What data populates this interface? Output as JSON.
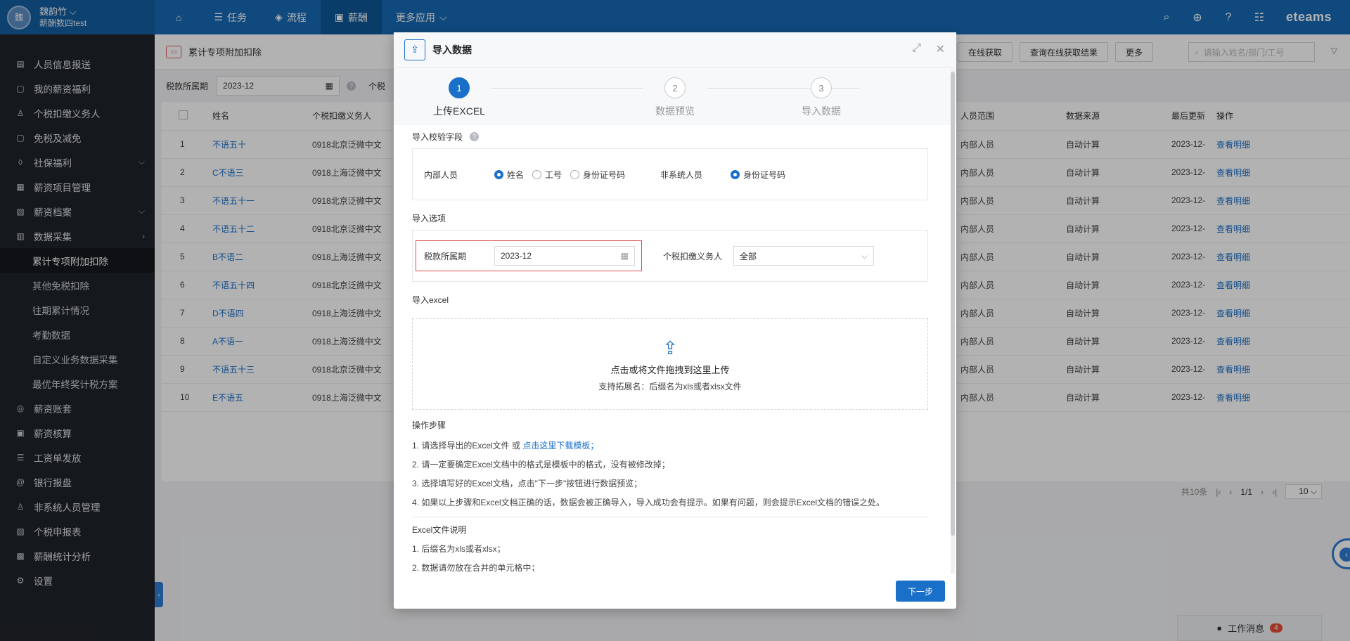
{
  "topbar": {
    "avatar_text": "魏",
    "user_name": "魏韵竹",
    "user_sub": "薪酬数四test",
    "nav": [
      {
        "label": "",
        "icon": "home-icon"
      },
      {
        "label": "任务",
        "icon": "list-icon"
      },
      {
        "label": "流程",
        "icon": "flow-icon"
      },
      {
        "label": "薪酬",
        "icon": "salary-icon",
        "active": true
      },
      {
        "label": "更多应用",
        "icon": "chevron-down-icon"
      }
    ],
    "brand": "eteams"
  },
  "sidebar": {
    "items": [
      {
        "label": "人员信息报送",
        "icon": "report-icon"
      },
      {
        "label": "我的薪资福利",
        "icon": "wallet-icon"
      },
      {
        "label": "个税扣缴义务人",
        "icon": "person-icon"
      },
      {
        "label": "免税及减免",
        "icon": "tax-icon"
      },
      {
        "label": "社保福利",
        "icon": "shield-icon",
        "arrow": "down"
      },
      {
        "label": "薪资项目管理",
        "icon": "project-icon"
      },
      {
        "label": "薪资档案",
        "icon": "archive-icon",
        "arrow": "down"
      },
      {
        "label": "数据采集",
        "icon": "data-icon",
        "arrow": "right"
      }
    ],
    "subitems": [
      {
        "label": "累计专项附加扣除",
        "active": true
      },
      {
        "label": "其他免税扣除"
      },
      {
        "label": "往期累计情况"
      },
      {
        "label": "考勤数据"
      },
      {
        "label": "自定义业务数据采集"
      },
      {
        "label": "最优年终奖计税方案"
      }
    ],
    "items2": [
      {
        "label": "薪资账套",
        "icon": "ledger-icon"
      },
      {
        "label": "薪资核算",
        "icon": "calc-icon"
      },
      {
        "label": "工资单发放",
        "icon": "payslip-icon"
      },
      {
        "label": "银行报盘",
        "icon": "bank-icon"
      },
      {
        "label": "非系统人员管理",
        "icon": "person-icon"
      },
      {
        "label": "个税申报表",
        "icon": "form-icon"
      },
      {
        "label": "薪酬统计分析",
        "icon": "chart-icon"
      },
      {
        "label": "设置",
        "icon": "gear-icon"
      }
    ]
  },
  "page": {
    "title": "累计专项附加扣除",
    "buttons": [
      "在线获取",
      "查询在线获取结果",
      "更多"
    ],
    "search_placeholder": "请输入姓名/部门/工号",
    "filter": {
      "label": "税款所属期",
      "value": "2023-12",
      "label2": "个税"
    },
    "table": {
      "headers": [
        "姓名",
        "个税扣缴义务人",
        "人员范围",
        "数据来源",
        "最后更新",
        "操作"
      ],
      "rows": [
        {
          "idx": "1",
          "name": "不语五十",
          "agent": "0918北京泛微中文",
          "scope": "内部人员",
          "source": "自动计算",
          "updated": "2023-12-",
          "op": "查看明细"
        },
        {
          "idx": "2",
          "name": "C不语三",
          "agent": "0918上海泛微中文",
          "scope": "内部人员",
          "source": "自动计算",
          "updated": "2023-12-",
          "op": "查看明细"
        },
        {
          "idx": "3",
          "name": "不语五十一",
          "agent": "0918北京泛微中文",
          "scope": "内部人员",
          "source": "自动计算",
          "updated": "2023-12-",
          "op": "查看明细"
        },
        {
          "idx": "4",
          "name": "不语五十二",
          "agent": "0918北京泛微中文",
          "scope": "内部人员",
          "source": "自动计算",
          "updated": "2023-12-",
          "op": "查看明细"
        },
        {
          "idx": "5",
          "name": "B不语二",
          "agent": "0918上海泛微中文",
          "scope": "内部人员",
          "source": "自动计算",
          "updated": "2023-12-",
          "op": "查看明细"
        },
        {
          "idx": "6",
          "name": "不语五十四",
          "agent": "0918北京泛微中文",
          "scope": "内部人员",
          "source": "自动计算",
          "updated": "2023-12-",
          "op": "查看明细"
        },
        {
          "idx": "7",
          "name": "D不语四",
          "agent": "0918上海泛微中文",
          "scope": "内部人员",
          "source": "自动计算",
          "updated": "2023-12-",
          "op": "查看明细"
        },
        {
          "idx": "8",
          "name": "A不语一",
          "agent": "0918上海泛微中文",
          "scope": "内部人员",
          "source": "自动计算",
          "updated": "2023-12-",
          "op": "查看明细"
        },
        {
          "idx": "9",
          "name": "不语五十三",
          "agent": "0918北京泛微中文",
          "scope": "内部人员",
          "source": "自动计算",
          "updated": "2023-12-",
          "op": "查看明细"
        },
        {
          "idx": "10",
          "name": "E不语五",
          "agent": "0918上海泛微中文",
          "scope": "内部人员",
          "source": "自动计算",
          "updated": "2023-12-",
          "op": "查看明细"
        }
      ]
    },
    "pager": {
      "total": "共10条",
      "page": "1/1",
      "size": "10"
    }
  },
  "message": {
    "label": "工作消息",
    "count": "4"
  },
  "modal": {
    "title": "导入数据",
    "steps": [
      {
        "num": "1",
        "label": "上传EXCEL",
        "active": true
      },
      {
        "num": "2",
        "label": "数据预览"
      },
      {
        "num": "3",
        "label": "导入数据"
      }
    ],
    "validate": {
      "title": "导入校验字段",
      "internal_label": "内部人员",
      "internal_options": [
        {
          "label": "姓名",
          "checked": true
        },
        {
          "label": "工号",
          "checked": false
        },
        {
          "label": "身份证号码",
          "checked": false
        }
      ],
      "external_label": "非系统人员",
      "external_options": [
        {
          "label": "身份证号码",
          "checked": true
        }
      ]
    },
    "options": {
      "title": "导入选项",
      "period_label": "税款所属期",
      "period_value": "2023-12",
      "agent_label": "个税扣缴义务人",
      "agent_value": "全部"
    },
    "excel": {
      "title": "导入excel",
      "upload_main": "点击或将文件拖拽到这里上传",
      "upload_sub": "支持拓展名：后缀名为xls或者xlsx文件"
    },
    "ops": {
      "title": "操作步骤",
      "step1_prefix": "1. 请选择导出的Excel文件 或",
      "step1_link": "点击这里下载模板；",
      "step2": "2. 请一定要确定Excel文档中的格式是模板中的格式，没有被修改掉；",
      "step3": "3. 选择填写好的Excel文档，点击\"下一步\"按钮进行数据预览；",
      "step4": "4. 如果以上步骤和Excel文档正确的话，数据会被正确导入，导入成功会有提示。如果有问题，则会提示Excel文档的错误之处。"
    },
    "excel_desc": {
      "title": "Excel文件说明",
      "line1": "1. 后缀名为xls或者xlsx；",
      "line2": "2. 数据请勿放在合并的单元格中；"
    },
    "next_label": "下一步"
  }
}
